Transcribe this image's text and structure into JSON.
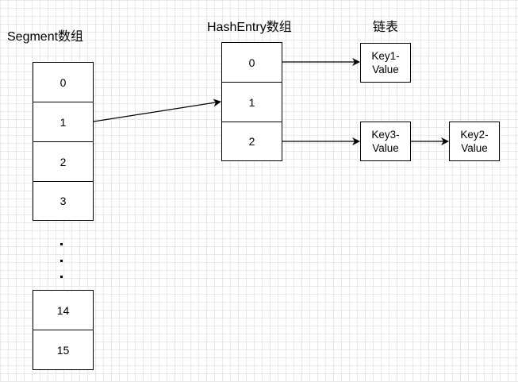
{
  "titles": {
    "segment": "Segment数组",
    "hashentry": "HashEntry数组",
    "list": "链表"
  },
  "segments": [
    "0",
    "1",
    "2",
    "3",
    "14",
    "15"
  ],
  "ellipsis": ".",
  "hash_entries": [
    "0",
    "1",
    "2"
  ],
  "nodes": {
    "key1": "Key1-\nValue",
    "key3": "Key3-\nValue",
    "key2": "Key2-\nValue"
  }
}
